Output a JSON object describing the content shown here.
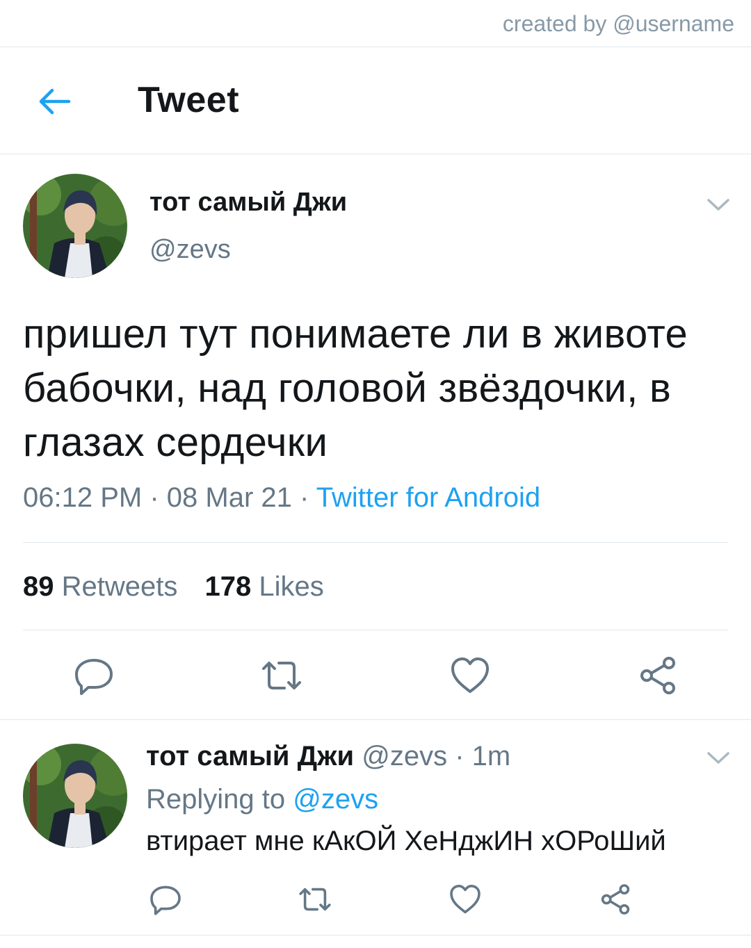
{
  "watermark": "created by @username",
  "header": {
    "title": "Tweet",
    "back_icon": "arrow-left-icon"
  },
  "colors": {
    "accent": "#1da1f2",
    "muted": "#657786",
    "text": "#14171a",
    "border": "#e1e8ed"
  },
  "tweet": {
    "display_name": "тот самый Джи",
    "handle": "@zevs",
    "text": "пришел тут понимаете ли в животе бабочки, над головой звёздочки, в глазах сердечки",
    "time": "06:12 PM",
    "separator": "·",
    "date": "08 Mar 21",
    "source": "Twitter for Android",
    "retweets_count": "89",
    "retweets_label": "Retweets",
    "likes_count": "178",
    "likes_label": "Likes"
  },
  "reply": {
    "display_name": "тот самый Джи",
    "handle": "@zevs",
    "separator": "·",
    "time_ago": "1m",
    "replying_label": "Replying to",
    "replying_to": "@zevs",
    "text": "втирает мне кАкОЙ ХеНджИН хОРоШий"
  },
  "actions": [
    "reply-icon",
    "retweet-icon",
    "like-icon",
    "share-icon"
  ]
}
